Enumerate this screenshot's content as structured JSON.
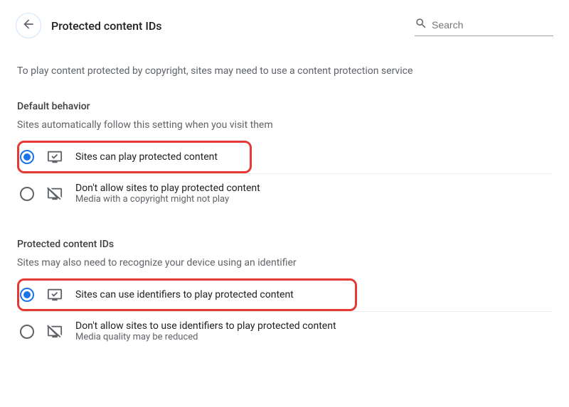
{
  "header": {
    "title": "Protected content IDs",
    "search_placeholder": "Search"
  },
  "intro": "To play content protected by copyright, sites may need to use a content protection service",
  "section1": {
    "title": "Default behavior",
    "subtitle": "Sites automatically follow this setting when you visit them",
    "options": [
      {
        "label": "Sites can play protected content",
        "desc": "",
        "checked": true,
        "highlight": true
      },
      {
        "label": "Don't allow sites to play protected content",
        "desc": "Media with a copyright might not play",
        "checked": false,
        "highlight": false
      }
    ]
  },
  "section2": {
    "title": "Protected content IDs",
    "subtitle": "Sites may also need to recognize your device using an identifier",
    "options": [
      {
        "label": "Sites can use identifiers to play protected content",
        "desc": "",
        "checked": true,
        "highlight": true
      },
      {
        "label": "Don't allow sites to use identifiers to play protected content",
        "desc": "Media quality may be reduced",
        "checked": false,
        "highlight": false
      }
    ]
  },
  "colors": {
    "accent": "#1a73e8",
    "highlight": "#e53935"
  }
}
